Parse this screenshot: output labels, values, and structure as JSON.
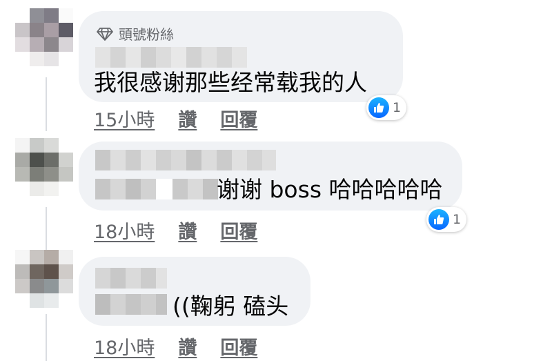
{
  "badge": {
    "label": "頭號粉絲",
    "icon": "diamond-icon"
  },
  "comments": [
    {
      "text": "我很感谢那些经常载我的人",
      "time": "15小時",
      "like_label": "讚",
      "reply_label": "回覆",
      "reaction": {
        "icon": "thumbs-up-icon",
        "count": "1"
      }
    },
    {
      "text": "谢谢 boss 哈哈哈哈哈",
      "time": "18小時",
      "like_label": "讚",
      "reply_label": "回覆",
      "reaction": {
        "icon": "thumbs-up-icon",
        "count": "1"
      }
    },
    {
      "text": "((鞠躬 磕头",
      "time": "18小時",
      "like_label": "讚",
      "reply_label": "回覆"
    }
  ],
  "colors": {
    "bubble": "#f0f2f5",
    "meta_text": "#65676b",
    "like_blue": "#0866ff",
    "text": "#050505"
  }
}
